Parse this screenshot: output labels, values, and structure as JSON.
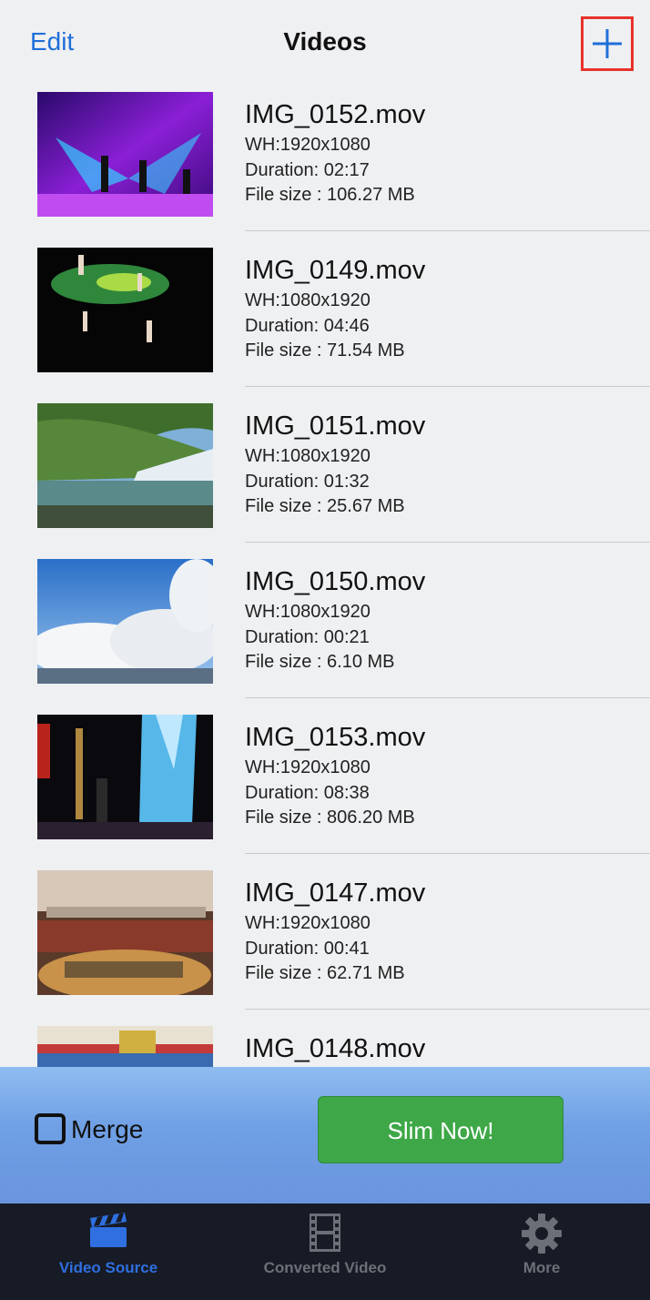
{
  "nav": {
    "edit_label": "Edit",
    "title": "Videos",
    "add_icon": "plus-icon"
  },
  "videos": [
    {
      "name": "IMG_0152.mov",
      "wh": "WH:1920x1080",
      "duration": "Duration: 02:17",
      "size": "File size : 106.27 MB"
    },
    {
      "name": "IMG_0149.mov",
      "wh": "WH:1080x1920",
      "duration": "Duration: 04:46",
      "size": "File size : 71.54 MB"
    },
    {
      "name": "IMG_0151.mov",
      "wh": "WH:1080x1920",
      "duration": "Duration: 01:32",
      "size": "File size : 25.67 MB"
    },
    {
      "name": "IMG_0150.mov",
      "wh": "WH:1080x1920",
      "duration": "Duration: 00:21",
      "size": "File size : 6.10 MB"
    },
    {
      "name": "IMG_0153.mov",
      "wh": "WH:1920x1080",
      "duration": "Duration: 08:38",
      "size": "File size : 806.20 MB"
    },
    {
      "name": "IMG_0147.mov",
      "wh": "WH:1920x1080",
      "duration": "Duration: 00:41",
      "size": "File size : 62.71 MB"
    },
    {
      "name": "IMG_0148.mov"
    }
  ],
  "actions": {
    "merge_label": "Merge",
    "merge_checked": false,
    "slim_label": "Slim Now!"
  },
  "tabs": [
    {
      "label": "Video Source",
      "icon": "clapperboard-icon",
      "active": true
    },
    {
      "label": "Converted Video",
      "icon": "film-strip-icon",
      "active": false
    },
    {
      "label": "More",
      "icon": "gear-icon",
      "active": false
    }
  ],
  "colors": {
    "accent": "#1f6fd8",
    "slim_button": "#3ea747",
    "tabbar_bg": "#171b25",
    "highlight_border": "#e8322c"
  }
}
